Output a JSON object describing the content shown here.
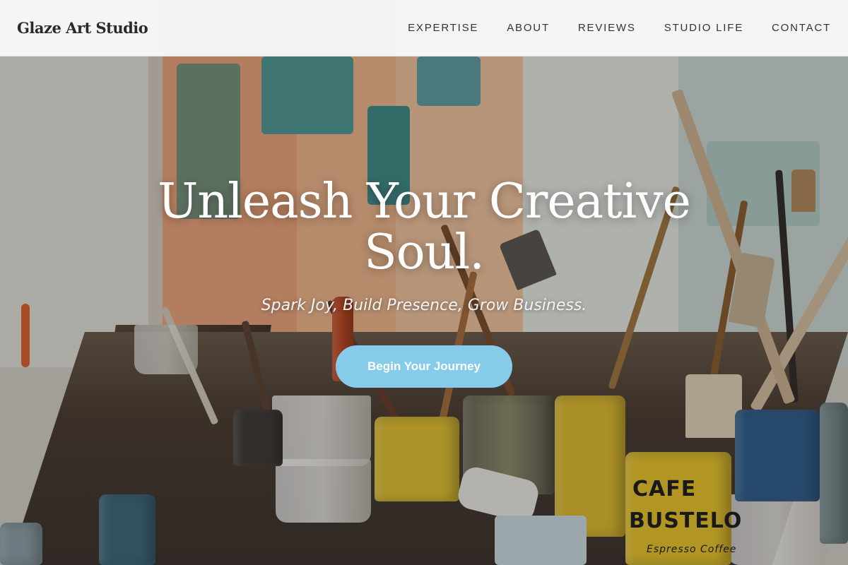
{
  "header": {
    "brand": "Glaze Art Studio",
    "nav": [
      {
        "label": "EXPERTISE"
      },
      {
        "label": "ABOUT"
      },
      {
        "label": "REVIEWS"
      },
      {
        "label": "STUDIO LIFE"
      },
      {
        "label": "CONTACT"
      }
    ]
  },
  "hero": {
    "title": "Unleash Your Creative Soul.",
    "subtitle": "Spark Joy, Build Presence, Grow Business.",
    "cta_label": "Begin Your Journey",
    "background_image": "art-studio-paint-brushes-and-cans",
    "can_label_1": "CAFE",
    "can_label_2": "BUSTELO",
    "can_label_3": "Espresso Coffee"
  },
  "colors": {
    "header_bg": "#f8f8f8",
    "cta_bg": "#86cbea",
    "title_text": "#ffffff"
  }
}
